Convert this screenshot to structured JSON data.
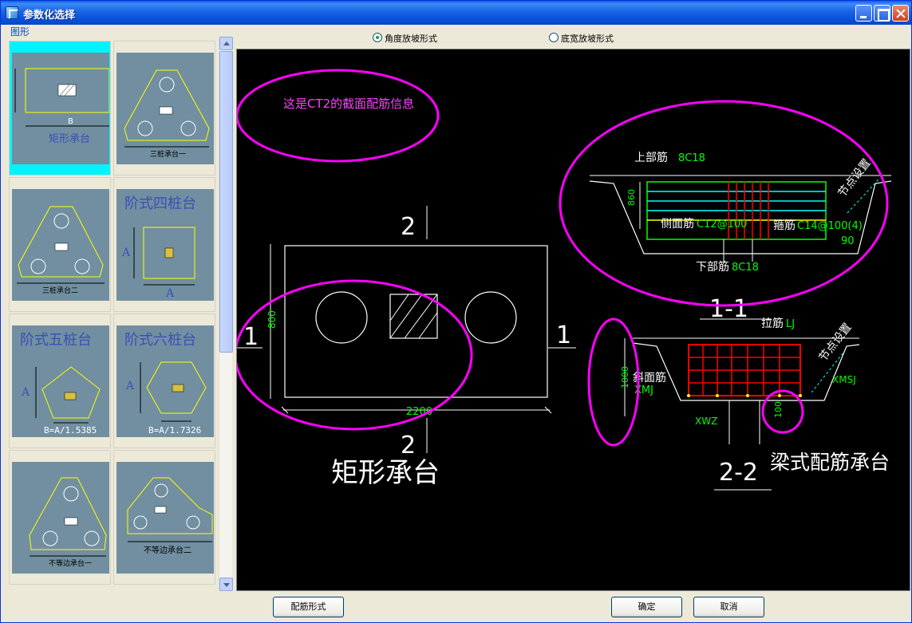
{
  "window": {
    "title": "参数化选择"
  },
  "gallery": {
    "label": "图形",
    "items": [
      {
        "label": "矩形承台",
        "selected": true
      },
      {
        "label": "三桩承台一",
        "selected": false
      },
      {
        "label": "三桩承台二",
        "selected": false
      },
      {
        "label": "阶式四桩台",
        "selected": false
      },
      {
        "label": "阶式五桩台",
        "formula": "B=A/1.5385",
        "selected": false
      },
      {
        "label": "阶式六桩台",
        "formula": "B=A/1.7326",
        "selected": false
      },
      {
        "label": "不等边承台一",
        "selected": false
      },
      {
        "label": "不等边承台二",
        "selected": false
      }
    ],
    "thumb_text": {
      "b": "B",
      "a": "A"
    }
  },
  "radios": {
    "angle": {
      "label": "角度放坡形式",
      "checked": true
    },
    "bottom": {
      "label": "底宽放坡形式",
      "checked": false
    }
  },
  "drawing": {
    "note": "这是CT2的截面配筋信息",
    "plan": {
      "title": "矩形承台",
      "dim_length": "2200",
      "dim_width": "800",
      "section1": "1",
      "section2": "2"
    },
    "section11": {
      "title": "1-1",
      "top_rebar_label": "上部筋",
      "top_rebar": "8C18",
      "side_rebar_label": "侧面筋",
      "side_rebar": "C12@100",
      "stirrup_label": "箍筋",
      "stirrup": "C14@100(4)",
      "bottom_rebar_label": "下部筋",
      "bottom_rebar": "8C18",
      "node_label": "节点设置",
      "height": "860",
      "angle": "90"
    },
    "section22": {
      "title": "2-2",
      "subtitle": "梁式配筋承台",
      "tie_label": "拉筋",
      "tie": "LJ",
      "slope_label": "斜面筋",
      "slope": "XMJ",
      "node_label": "节点设置",
      "height": "1000",
      "xwz": "XWZ",
      "xmsj": "XMSJ",
      "cover": "100"
    }
  },
  "footer": {
    "config_button": "配筋形式",
    "ok_button": "确定",
    "cancel_button": "取消"
  },
  "colors": {
    "highlight": "#ff00ff",
    "selection": "#00f3ff",
    "thumb_bg": "#718fa0",
    "outline": "#ffff00"
  }
}
